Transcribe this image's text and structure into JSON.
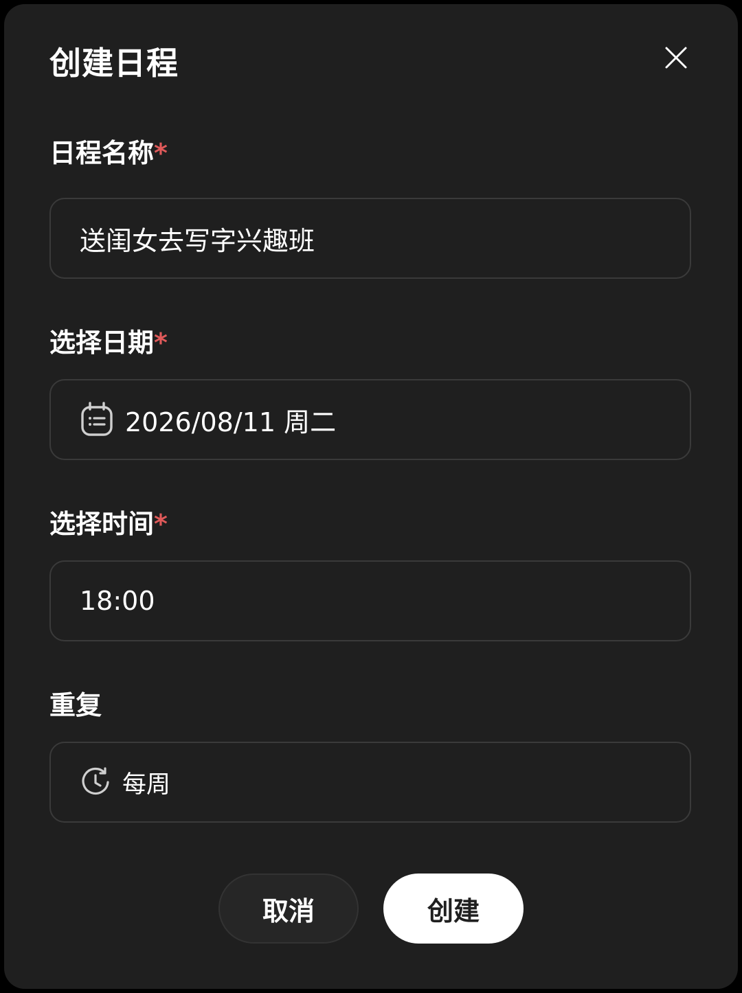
{
  "dialog": {
    "title": "创建日程",
    "close_icon": "close-icon"
  },
  "fields": {
    "name": {
      "label": "日程名称",
      "required_mark": "*",
      "value": "送闺女去写字兴趣班"
    },
    "date": {
      "label": "选择日期",
      "required_mark": "*",
      "icon": "calendar-icon",
      "value": "2026/08/11 周二"
    },
    "time": {
      "label": "选择时间",
      "required_mark": "*",
      "value": "18:00"
    },
    "repeat": {
      "label": "重复",
      "icon": "repeat-clock-icon",
      "value": "每周"
    }
  },
  "buttons": {
    "cancel_label": "取消",
    "create_label": "创建"
  },
  "colors": {
    "dialog_bg": "#1f1f1f",
    "required": "#e05a5a",
    "primary_button_bg": "#ffffff"
  }
}
